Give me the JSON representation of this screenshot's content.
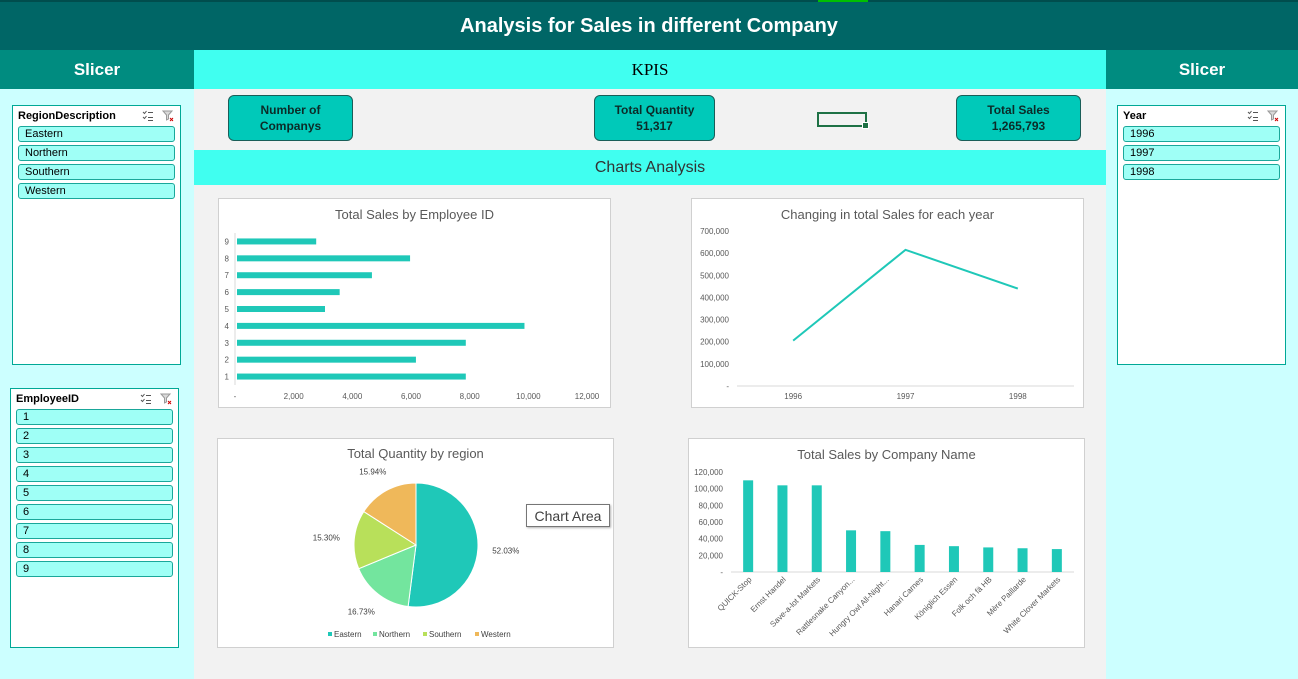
{
  "title": "Analysis for Sales in different Company",
  "slicer_left_header": "Slicer",
  "slicer_right_header": "Slicer",
  "kpis_header": "KPIS",
  "charts_header": "Charts Analysis",
  "region_slicer": {
    "title": "RegionDescription",
    "items": [
      "Eastern",
      "Northern",
      "Southern",
      "Western"
    ]
  },
  "employee_slicer": {
    "title": "EmployeeID",
    "items": [
      "1",
      "2",
      "3",
      "4",
      "5",
      "6",
      "7",
      "8",
      "9"
    ]
  },
  "year_slicer": {
    "title": "Year",
    "items": [
      "1996",
      "1997",
      "1998"
    ]
  },
  "kpis": {
    "companies": {
      "label": "Number of Companys",
      "line1": "Number of",
      "line2": "Companys"
    },
    "quantity": {
      "label": "Total Quantity",
      "value": "51,317"
    },
    "sales": {
      "label": "Total Sales",
      "value": "1,265,793"
    }
  },
  "tooltip": "Chart Area",
  "colors": {
    "accent": "#1fc8b8",
    "title_bar": "#006666",
    "slicer_head": "#008c80",
    "band": "#40fff0",
    "side_bg": "#ccffff",
    "pie": [
      "#1fc8b8",
      "#73e59e",
      "#b8e05a",
      "#efb85a"
    ]
  },
  "chart_data": [
    {
      "type": "bar",
      "orientation": "horizontal",
      "title": "Total Sales by Employee ID",
      "categories": [
        "1",
        "2",
        "3",
        "4",
        "5",
        "6",
        "7",
        "8",
        "9"
      ],
      "values": [
        7800,
        6100,
        7800,
        9800,
        3000,
        3500,
        4600,
        5900,
        2700
      ],
      "xlim": [
        0,
        12000
      ],
      "x_ticks": [
        "-",
        "2,000",
        "4,000",
        "6,000",
        "8,000",
        "10,000",
        "12,000"
      ],
      "grid": false
    },
    {
      "type": "line",
      "title": "Changing in total Sales for each year",
      "x": [
        "1996",
        "1997",
        "1998"
      ],
      "values": [
        205000,
        615000,
        440000
      ],
      "ylim": [
        0,
        700000
      ],
      "y_ticks": [
        "-",
        "100,000",
        "200,000",
        "300,000",
        "400,000",
        "500,000",
        "600,000",
        "700,000"
      ],
      "grid": false
    },
    {
      "type": "pie",
      "title": "Total Quantity by region",
      "labels": [
        "Eastern",
        "Northern",
        "Southern",
        "Western"
      ],
      "values": [
        52.03,
        16.73,
        15.3,
        15.94
      ],
      "data_labels": [
        "52.03%",
        "16.73%",
        "15.30%",
        "15.94%"
      ],
      "legend": "bottom"
    },
    {
      "type": "bar",
      "title": "Total Sales by Company Name",
      "categories": [
        "QUICK-Stop",
        "Ernst Handel",
        "Save-a-lot Markets",
        "Rattlesnake Canyon...",
        "Hungry Owl All-Night...",
        "Hanari Carnes",
        "Königlich Essen",
        "Folk och fä HB",
        "Mère Paillarde",
        "White Clover Markets"
      ],
      "values": [
        110000,
        104000,
        104000,
        50000,
        49000,
        32500,
        31000,
        29500,
        28500,
        27500
      ],
      "ylim": [
        0,
        120000
      ],
      "y_ticks": [
        "-",
        "20,000",
        "40,000",
        "60,000",
        "80,000",
        "100,000",
        "120,000"
      ],
      "grid": false
    }
  ]
}
